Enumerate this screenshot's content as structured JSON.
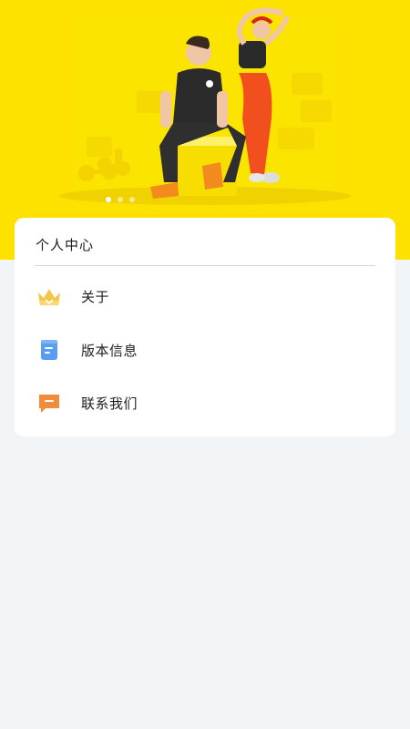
{
  "banner": {
    "slides": 3,
    "active_slide": 1,
    "background_color": "#fde200"
  },
  "card": {
    "title": "个人中心",
    "items": [
      {
        "label": "关于",
        "icon": "crown-icon",
        "color": "#f7c54a"
      },
      {
        "label": "版本信息",
        "icon": "document-icon",
        "color": "#5a9df5"
      },
      {
        "label": "联系我们",
        "icon": "chat-bubble-icon",
        "color": "#f08c3a"
      }
    ]
  }
}
